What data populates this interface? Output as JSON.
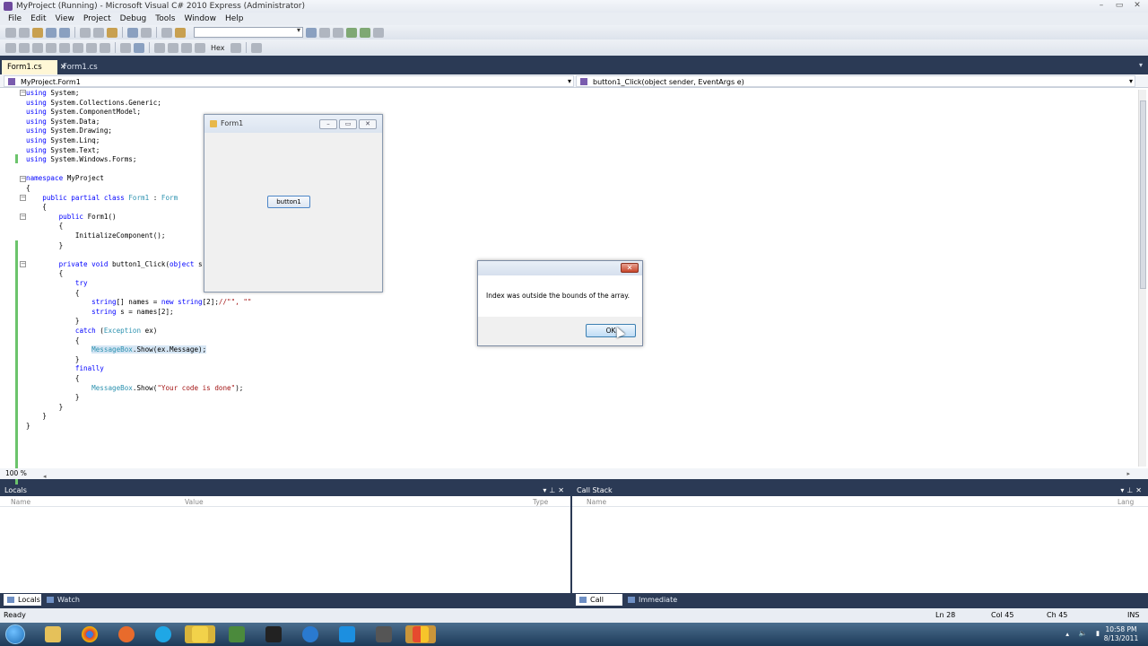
{
  "window": {
    "title": "MyProject (Running) - Microsoft Visual C# 2010 Express (Administrator)"
  },
  "menu": [
    "File",
    "Edit",
    "View",
    "Project",
    "Debug",
    "Tools",
    "Window",
    "Help"
  ],
  "toolbar": {
    "hex_label": "Hex"
  },
  "tabs": [
    {
      "label": "Form1.cs"
    },
    {
      "label": "Form1.cs [Design]"
    }
  ],
  "nav": {
    "class_combo": "MyProject.Form1",
    "member_combo": "button1_Click(object sender, EventArgs e)"
  },
  "code_lines": [
    "using System;",
    "using System.Collections.Generic;",
    "using System.ComponentModel;",
    "using System.Data;",
    "using System.Drawing;",
    "using System.Linq;",
    "using System.Text;",
    "using System.Windows.Forms;",
    "",
    "namespace MyProject",
    "{",
    "    public partial class Form1 : Form",
    "    {",
    "        public Form1()",
    "        {",
    "            InitializeComponent();",
    "        }",
    "",
    "        private void button1_Click(object s",
    "        {",
    "            try",
    "            {",
    "                string[] names = new string[2];//\"\", \"\"",
    "                string s = names[2];",
    "            }",
    "            catch (Exception ex)",
    "            {",
    "                MessageBox.Show(ex.Message);",
    "            }",
    "            finally",
    "            {",
    "                MessageBox.Show(\"Your code is done\");",
    "            }",
    "        }",
    "    }",
    "}"
  ],
  "zoom": "100 %",
  "form1": {
    "title": "Form1",
    "button_label": "button1"
  },
  "message_box": {
    "text": "Index was outside the bounds of the array.",
    "ok_label": "OK"
  },
  "locals_pane": {
    "title": "Locals",
    "columns": [
      "Name",
      "Value",
      "Type"
    ]
  },
  "callstack_pane": {
    "title": "Call Stack",
    "columns": [
      "Name",
      "Lang"
    ]
  },
  "bottom_tabs_left": [
    "Locals",
    "Watch"
  ],
  "bottom_tabs_right": [
    "Call Stack",
    "Immediate Window"
  ],
  "status": {
    "ready": "Ready",
    "line": "Ln 28",
    "col": "Col 45",
    "ch": "Ch 45",
    "mode": "INS"
  },
  "tray": {
    "time": "10:58 PM",
    "date": "8/13/2011"
  },
  "colors": {
    "ide_dark": "#2b3a55",
    "keyword": "#0000ff",
    "type": "#2b91af",
    "string": "#a31515",
    "change_marker": "#6cc46c"
  },
  "taskbar_icons": [
    "folder-icon",
    "chrome-icon",
    "firefox-icon",
    "skype-icon",
    "app-icon",
    "visual-csharp-icon",
    "media-icon",
    "itunes-icon",
    "teamviewer-icon",
    "tool-icon",
    "windows-icon"
  ]
}
